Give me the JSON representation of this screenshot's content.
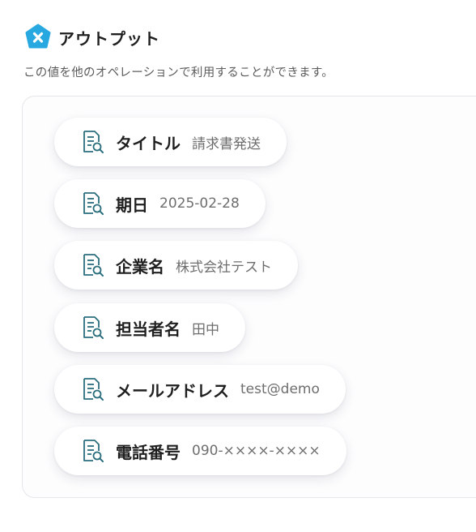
{
  "header": {
    "title": "アウトプット",
    "subtitle": "この値を他のオペレーションで利用することができます。"
  },
  "colors": {
    "logo_blue": "#27a8e0",
    "icon_teal": "#2a6e7d"
  },
  "outputs": [
    {
      "label": "タイトル",
      "value": "請求書発送",
      "icon": "document-search-icon"
    },
    {
      "label": "期日",
      "value": "2025-02-28",
      "icon": "document-search-icon"
    },
    {
      "label": "企業名",
      "value": "株式会社テスト",
      "icon": "document-search-icon"
    },
    {
      "label": "担当者名",
      "value": "田中",
      "icon": "document-search-icon"
    },
    {
      "label": "メールアドレス",
      "value": "test@demo",
      "icon": "document-search-icon"
    },
    {
      "label": "電話番号",
      "value": "090-××××-××××",
      "icon": "document-search-icon"
    }
  ]
}
